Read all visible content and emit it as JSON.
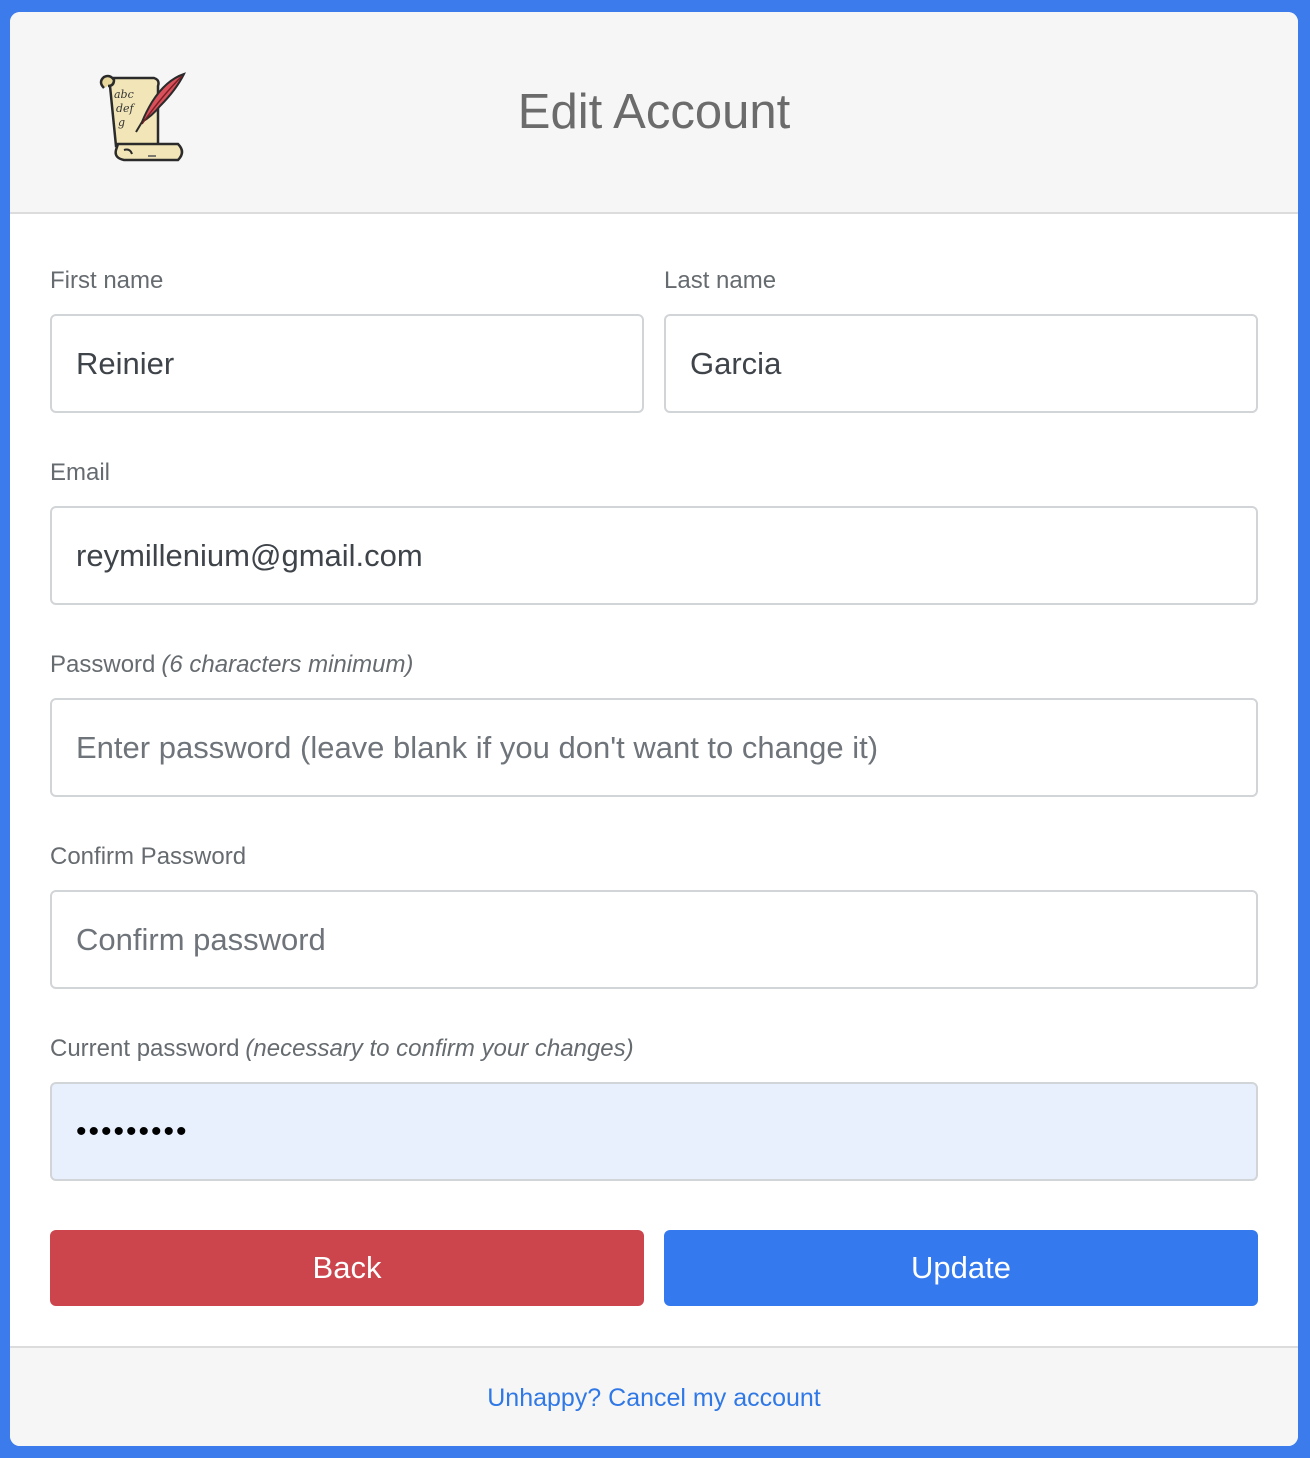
{
  "header": {
    "title": "Edit Account",
    "logo_icon": "scroll-quill-icon"
  },
  "form": {
    "first_name": {
      "label": "First name",
      "value": "Reinier"
    },
    "last_name": {
      "label": "Last name",
      "value": "Garcia"
    },
    "email": {
      "label": "Email",
      "value": "reymillenium@gmail.com"
    },
    "password": {
      "label": "Password",
      "hint": "(6 characters minimum)",
      "placeholder": "Enter password (leave blank if you don't want to change it)"
    },
    "confirm_password": {
      "label": "Confirm Password",
      "placeholder": "Confirm password"
    },
    "current_password": {
      "label": "Current password",
      "hint": "(necessary to confirm your changes)",
      "value": "•••••••••"
    }
  },
  "buttons": {
    "back": "Back",
    "update": "Update"
  },
  "footer": {
    "cancel_link": "Unhappy? Cancel my account"
  },
  "colors": {
    "page_background": "#3b7bec",
    "back_button": "#cc444c",
    "update_button": "#3579ef",
    "link": "#2f78e6",
    "autofill_field": "#e8f0fe"
  }
}
